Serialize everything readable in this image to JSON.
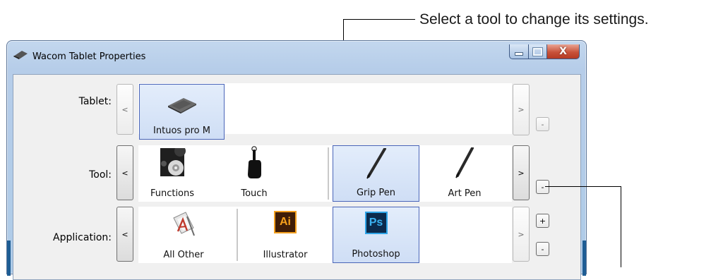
{
  "callouts": {
    "select_tool": "Select a tool to change its settings."
  },
  "window": {
    "title": "Wacom Tablet Properties",
    "caption": {
      "minimize": "–",
      "maximize": "□",
      "close": "X"
    }
  },
  "tablet_row": {
    "label": "Tablet:",
    "prev": "<",
    "next": ">",
    "remove": "-",
    "items": [
      {
        "label": "Intuos pro M",
        "icon": "tablet-icon",
        "selected": true
      }
    ]
  },
  "tool_row": {
    "label": "Tool:",
    "prev": "<",
    "next": ">",
    "remove": "-",
    "items": [
      {
        "label": "Functions",
        "icon": "functions-icon",
        "selected": false
      },
      {
        "label": "Touch",
        "icon": "touch-hand-icon",
        "selected": false
      },
      {
        "label": "Grip Pen",
        "icon": "grip-pen-icon",
        "selected": true
      },
      {
        "label": "Art Pen",
        "icon": "art-pen-icon",
        "selected": false
      }
    ]
  },
  "application_row": {
    "label": "Application:",
    "prev": "<",
    "next": ">",
    "add": "+",
    "remove": "-",
    "items": [
      {
        "label": "All Other",
        "icon": "all-other-apps-icon",
        "selected": false
      },
      {
        "label": "Illustrator",
        "icon": "illustrator-icon",
        "badge": "Ai",
        "selected": false
      },
      {
        "label": "Photoshop",
        "icon": "photoshop-icon",
        "badge": "Ps",
        "selected": true
      }
    ]
  },
  "colors": {
    "selection_border": "#4a65b8",
    "selection_fill": "#dce8f8",
    "window_frame": "#b6cde9",
    "close_red": "#c8523a"
  }
}
